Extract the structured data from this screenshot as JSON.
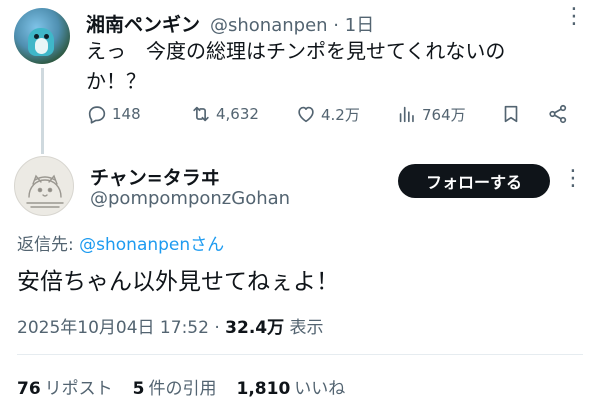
{
  "parent_tweet": {
    "display_name": "湘南ペンギン",
    "handle": "@shonanpen",
    "separator": "·",
    "time": "1日",
    "text_line1": "えっ　今度の総理はチンポを見せてくれないの",
    "text_line2": "か！？",
    "actions": {
      "replies": "148",
      "retweets": "4,632",
      "likes": "4.2万",
      "views": "764万"
    }
  },
  "main_tweet": {
    "display_name": "チャン=タラヰ",
    "handle": "@pompomponzGohan",
    "follow_label": "フォローする",
    "reply_prefix": "返信先: ",
    "reply_mention": "@shonanpenさん",
    "text": "安倍ちゃん以外見せてねぇよ！",
    "timestamp": "2025年10月04日 17:52",
    "meta_separator": " · ",
    "views_count": "32.4万",
    "views_label": "表示",
    "stats": {
      "retweets_count": "76",
      "retweets_label": "リポスト",
      "quotes_count": "5",
      "quotes_label": "件の引用",
      "likes_count": "1,810",
      "likes_label": "いいね"
    }
  },
  "colors": {
    "accent": "#1d9bf0",
    "secondary_text": "#536471",
    "primary_text": "#0f1419",
    "follow_button_bg": "#0f1419"
  }
}
